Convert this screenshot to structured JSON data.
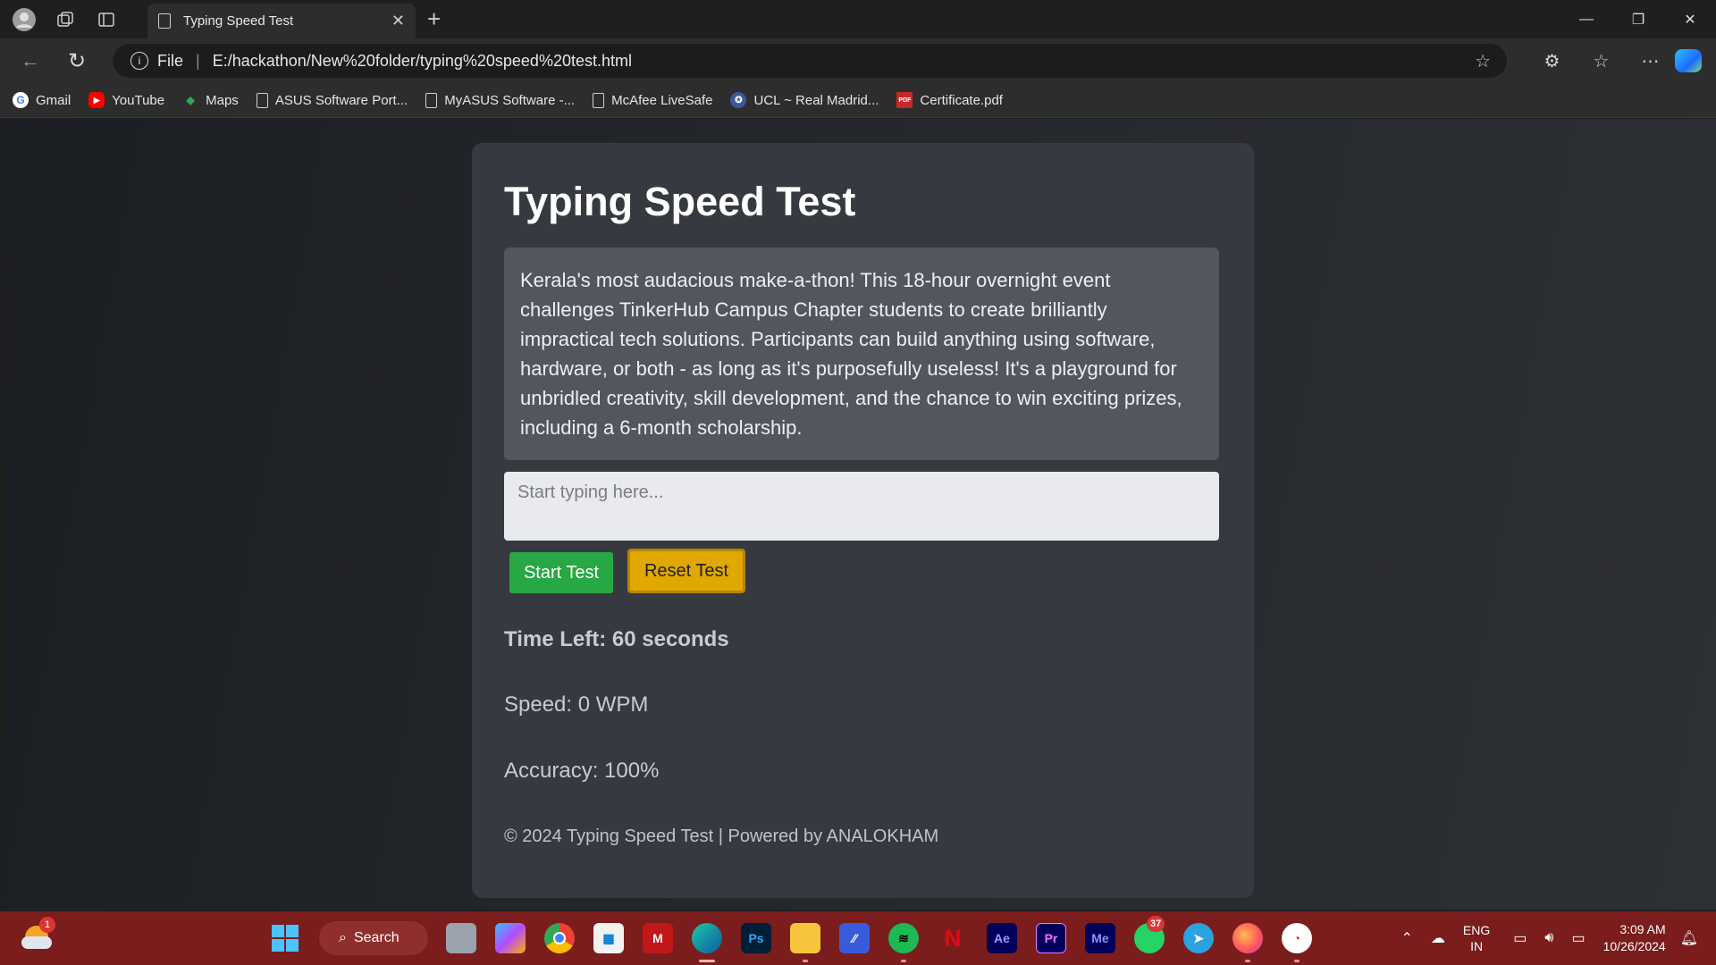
{
  "browser": {
    "tab_title": "Typing Speed Test",
    "address_scheme": "File",
    "url": "E:/hackathon/New%20folder/typing%20speed%20test.html",
    "bookmarks": [
      {
        "label": "Gmail",
        "icon": "gmail-icon"
      },
      {
        "label": "YouTube",
        "icon": "youtube-icon"
      },
      {
        "label": "Maps",
        "icon": "maps-icon"
      },
      {
        "label": "ASUS Software Port...",
        "icon": "page-icon"
      },
      {
        "label": "MyASUS Software -...",
        "icon": "page-icon"
      },
      {
        "label": "McAfee LiveSafe",
        "icon": "page-icon"
      },
      {
        "label": "UCL ~ Real Madrid...",
        "icon": "ucl-icon"
      },
      {
        "label": "Certificate.pdf",
        "icon": "pdf-icon"
      }
    ]
  },
  "app": {
    "title": "Typing Speed Test",
    "passage": "Kerala's most audacious make-a-thon! This 18-hour overnight event challenges TinkerHub Campus Chapter students to create brilliantly impractical tech solutions. Participants can build anything using software, hardware, or both - as long as it's purposefully useless! It's a playground for unbridled creativity, skill development, and the chance to win exciting prizes, including a 6-month scholarship.",
    "input_placeholder": "Start typing here...",
    "start_label": "Start Test",
    "reset_label": "Reset Test",
    "time_left": "Time Left: 60 seconds",
    "speed": "Speed: 0 WPM",
    "accuracy": "Accuracy: 100%",
    "footer": "© 2024 Typing Speed Test | Powered by ANALOKHAM"
  },
  "taskbar": {
    "weather_badge": "1",
    "search_label": "Search",
    "whatsapp_badge": "37",
    "apps": [
      "task-view",
      "copilot",
      "chrome",
      "microsoft-store",
      "mcafee",
      "edge",
      "photoshop",
      "file-explorer",
      "app-maker",
      "spotify",
      "netflix",
      "after-effects",
      "premiere-pro",
      "media-encoder",
      "whatsapp",
      "telegram",
      "firefox",
      "davinci-resolve"
    ],
    "lang_top": "ENG",
    "lang_bottom": "IN",
    "time": "3:09 AM",
    "date": "10/26/2024"
  },
  "colors": {
    "start_button": "#28a745",
    "reset_button": "#e0a800",
    "card": "#36393f",
    "taskbar": "#7b1d1c"
  }
}
